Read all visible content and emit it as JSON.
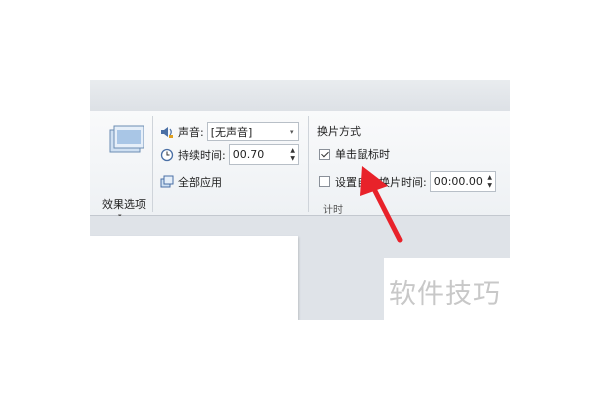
{
  "effects": {
    "label": "效果选项",
    "dropdown_glyph": "▾"
  },
  "sound": {
    "label": "声音:",
    "value": "[无声音]"
  },
  "duration": {
    "label": "持续时间:",
    "value": "00.70"
  },
  "apply_all": {
    "label": "全部应用"
  },
  "advance": {
    "title": "换片方式",
    "on_click": {
      "label": "单击鼠标时",
      "checked": true
    },
    "after": {
      "label": "设置自动换片时间:",
      "value": "00:00.00",
      "checked": false
    }
  },
  "group_label": "计时",
  "watermark": "软件技巧",
  "spinner": {
    "up": "▲",
    "down": "▼"
  },
  "colors": {
    "arrow": "#e8222a",
    "ribbon": "#f4f6f8",
    "workspace": "#dfe3e8"
  }
}
